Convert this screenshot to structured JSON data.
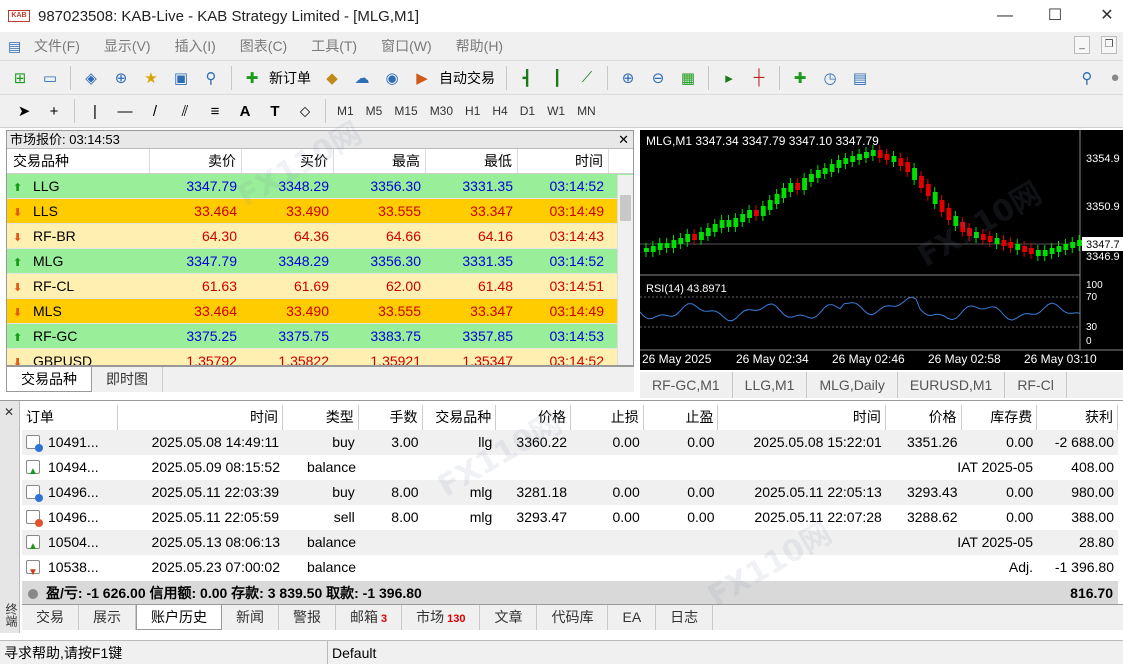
{
  "window": {
    "title": "987023508: KAB-Live - KAB Strategy Limited - [MLG,M1]",
    "logo": "KAB"
  },
  "menu": [
    "文件(F)",
    "显示(V)",
    "插入(I)",
    "图表(C)",
    "工具(T)",
    "窗口(W)",
    "帮助(H)"
  ],
  "toolbar": {
    "new_order": "新订单",
    "auto_trading": "自动交易"
  },
  "toolbar2": {
    "text_tool": "A",
    "text_label_tool": "T",
    "timeframes": [
      "M1",
      "M5",
      "M15",
      "M30",
      "H1",
      "H4",
      "D1",
      "W1",
      "MN"
    ]
  },
  "market_watch": {
    "title": "市场报价: 03:14:53",
    "columns": [
      "交易品种",
      "卖价",
      "买价",
      "最高",
      "最低",
      "时间"
    ],
    "rows": [
      {
        "symbol": "LLG",
        "bid": "3347.79",
        "ask": "3348.29",
        "high": "3356.30",
        "low": "3331.35",
        "time": "03:14:52",
        "dir": "up"
      },
      {
        "symbol": "LLS",
        "bid": "33.464",
        "ask": "33.490",
        "high": "33.555",
        "low": "33.347",
        "time": "03:14:49",
        "dir": "down1"
      },
      {
        "symbol": "RF-BR",
        "bid": "64.30",
        "ask": "64.36",
        "high": "64.66",
        "low": "64.16",
        "time": "03:14:43",
        "dir": "down2"
      },
      {
        "symbol": "MLG",
        "bid": "3347.79",
        "ask": "3348.29",
        "high": "3356.30",
        "low": "3331.35",
        "time": "03:14:52",
        "dir": "up"
      },
      {
        "symbol": "RF-CL",
        "bid": "61.63",
        "ask": "61.69",
        "high": "62.00",
        "low": "61.48",
        "time": "03:14:51",
        "dir": "down2"
      },
      {
        "symbol": "MLS",
        "bid": "33.464",
        "ask": "33.490",
        "high": "33.555",
        "low": "33.347",
        "time": "03:14:49",
        "dir": "down1"
      },
      {
        "symbol": "RF-GC",
        "bid": "3375.25",
        "ask": "3375.75",
        "high": "3383.75",
        "low": "3357.85",
        "time": "03:14:53",
        "dir": "up"
      },
      {
        "symbol": "GBPUSD",
        "bid": "1.35792",
        "ask": "1.35822",
        "high": "1.35921",
        "low": "1.35347",
        "time": "03:14:52",
        "dir": "down2"
      }
    ],
    "tabs": [
      "交易品种",
      "即时图"
    ]
  },
  "chart": {
    "header": "MLG,M1  3347.34 3347.79 3347.10 3347.79",
    "price_labels": [
      "3354.9",
      "3350.9",
      "3347.7",
      "3346.9"
    ],
    "rsi_label": "RSI(14) 43.8971",
    "rsi_levels": [
      "100",
      "70",
      "30",
      "0"
    ],
    "time_labels": [
      "26 May 2025",
      "26 May 02:34",
      "26 May 02:46",
      "26 May 02:58",
      "26 May 03:10"
    ],
    "colors": {
      "bull": "#00e000",
      "bear": "#e00000",
      "rsi": "#3a7dd8"
    }
  },
  "chart_tabs": [
    "RF-GC,M1",
    "LLG,M1",
    "MLG,Daily",
    "EURUSD,M1",
    "RF-Cl"
  ],
  "history": {
    "columns": [
      "订单",
      "时间",
      "类型",
      "手数",
      "交易品种",
      "价格",
      "止损",
      "止盈",
      "时间",
      "价格",
      "库存费",
      "获利"
    ],
    "rows": [
      {
        "order": "10491...",
        "time": "2025.05.08 14:49:11",
        "type": "buy",
        "volume": "3.00",
        "symbol": "llg",
        "price": "3360.22",
        "sl": "0.00",
        "tp": "0.00",
        "ctime": "2025.05.08 15:22:01",
        "cprice": "3351.26",
        "swap": "0.00",
        "profit": "-2 688.00",
        "icon": "buy"
      },
      {
        "order": "10494...",
        "time": "2025.05.09 08:15:52",
        "type": "balance",
        "comment": "IAT 2025-05",
        "profit": "408.00",
        "icon": "bal-up"
      },
      {
        "order": "10496...",
        "time": "2025.05.11 22:03:39",
        "type": "buy",
        "volume": "8.00",
        "symbol": "mlg",
        "price": "3281.18",
        "sl": "0.00",
        "tp": "0.00",
        "ctime": "2025.05.11 22:05:13",
        "cprice": "3293.43",
        "swap": "0.00",
        "profit": "980.00",
        "icon": "buy"
      },
      {
        "order": "10496...",
        "time": "2025.05.11 22:05:59",
        "type": "sell",
        "volume": "8.00",
        "symbol": "mlg",
        "price": "3293.47",
        "sl": "0.00",
        "tp": "0.00",
        "ctime": "2025.05.11 22:07:28",
        "cprice": "3288.62",
        "swap": "0.00",
        "profit": "388.00",
        "icon": "sell"
      },
      {
        "order": "10504...",
        "time": "2025.05.13 08:06:13",
        "type": "balance",
        "comment": "IAT 2025-05",
        "profit": "28.80",
        "icon": "bal-up"
      },
      {
        "order": "10538...",
        "time": "2025.05.23 07:00:02",
        "type": "balance",
        "comment": "Adj.",
        "profit": "-1 396.80",
        "icon": "bal-dn"
      }
    ],
    "summary": "盈/亏: -1 626.00 信用额: 0.00 存款: 3 839.50 取款: -1 396.80",
    "total": "816.70"
  },
  "terminal_tabs": [
    {
      "label": "交易"
    },
    {
      "label": "展示"
    },
    {
      "label": "账户历史",
      "active": true
    },
    {
      "label": "新闻"
    },
    {
      "label": "警报"
    },
    {
      "label": "邮箱",
      "badge": "3"
    },
    {
      "label": "市场",
      "badge": "130"
    },
    {
      "label": "文章"
    },
    {
      "label": "代码库"
    },
    {
      "label": "EA"
    },
    {
      "label": "日志"
    }
  ],
  "terminal_side_label": "终端",
  "status": {
    "help": "寻求帮助,请按F1键",
    "profile": "Default"
  },
  "watermark": "FX110网"
}
